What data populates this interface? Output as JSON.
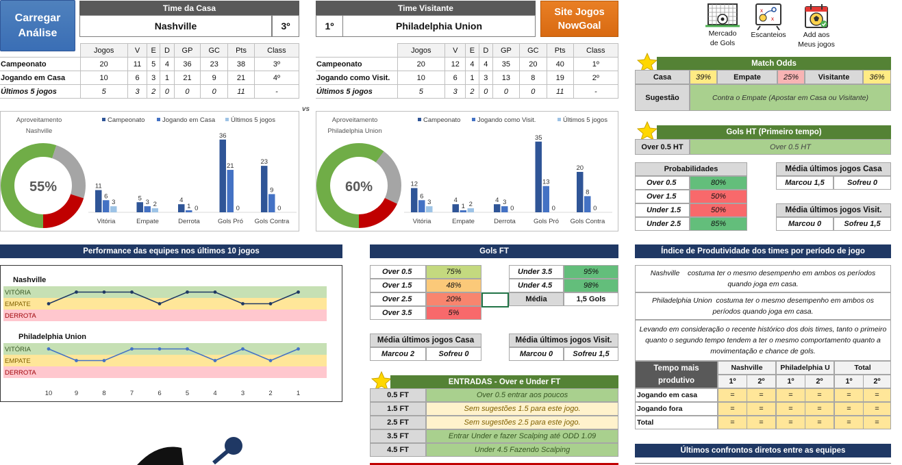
{
  "buttons": {
    "load": "Carregar\nAnálise",
    "site": "Site Jogos\nNowGoal"
  },
  "icons": [
    {
      "name": "goal-net-icon",
      "label": "Mercado\nde Gols"
    },
    {
      "name": "tactics-board-icon",
      "label": "Escanteios"
    },
    {
      "name": "calendar-ball-icon",
      "label": "Add aos\nMeus jogos"
    }
  ],
  "home": {
    "header": "Time da Casa",
    "name": "Nashville",
    "pos": "3º",
    "cols": [
      "Jogos",
      "V",
      "E",
      "D",
      "GP",
      "GC",
      "Pts",
      "Class"
    ],
    "rows": [
      {
        "label": "Campeonato",
        "vals": [
          "20",
          "11",
          "5",
          "4",
          "36",
          "23",
          "38",
          "3º"
        ],
        "italic": false
      },
      {
        "label": "Jogando em Casa",
        "vals": [
          "10",
          "6",
          "3",
          "1",
          "21",
          "9",
          "21",
          "4º"
        ],
        "italic": false
      },
      {
        "label": "Últimos 5 jogos",
        "vals": [
          "5",
          "3",
          "2",
          "0",
          "0",
          "0",
          "11",
          "-"
        ],
        "italic": true
      }
    ]
  },
  "away": {
    "header": "Time Visitante",
    "name": "Philadelphia Union",
    "pos": "1º",
    "cols": [
      "Jogos",
      "V",
      "E",
      "D",
      "GP",
      "GC",
      "Pts",
      "Class"
    ],
    "rows": [
      {
        "label": "Campeonato",
        "vals": [
          "20",
          "12",
          "4",
          "4",
          "35",
          "20",
          "40",
          "1º"
        ],
        "italic": false
      },
      {
        "label": "Jogando como Visit.",
        "vals": [
          "10",
          "6",
          "1",
          "3",
          "13",
          "8",
          "19",
          "2º"
        ],
        "italic": false
      },
      {
        "label": "Últimos 5 jogos",
        "vals": [
          "5",
          "3",
          "2",
          "0",
          "0",
          "0",
          "11",
          "-"
        ],
        "italic": true
      }
    ]
  },
  "vs": "vs",
  "chart_data": [
    {
      "type": "bar",
      "title": "Aproveitamento Nashville",
      "donut_value": "55%",
      "donut_fraction": 0.55,
      "categories": [
        "Vitória",
        "Empate",
        "Derrota",
        "Gols Pró",
        "Gols Contra"
      ],
      "series": [
        {
          "name": "Campeonato",
          "values": [
            11,
            5,
            4,
            36,
            23
          ],
          "color": "#2f5597"
        },
        {
          "name": "Jogando em Casa",
          "values": [
            6,
            3,
            1,
            21,
            9
          ],
          "color": "#4472c4"
        },
        {
          "name": "Últimos 5 jogos",
          "values": [
            3,
            2,
            0,
            0,
            0
          ],
          "color": "#9dc3e6"
        }
      ]
    },
    {
      "type": "bar",
      "title": "Aproveitamento Philadelphia Union",
      "donut_value": "60%",
      "donut_fraction": 0.6,
      "categories": [
        "Vitória",
        "Empate",
        "Derrota",
        "Gols Pró",
        "Gols Contra"
      ],
      "series": [
        {
          "name": "Campeonato",
          "values": [
            12,
            4,
            4,
            35,
            20
          ],
          "color": "#2f5597"
        },
        {
          "name": "Jogando como Visit.",
          "values": [
            6,
            1,
            3,
            13,
            8
          ],
          "color": "#4472c4"
        },
        {
          "name": "Últimos 5 jogos",
          "values": [
            3,
            2,
            0,
            0,
            0
          ],
          "color": "#9dc3e6"
        }
      ]
    },
    {
      "type": "line",
      "title": "Performance das equipes nos últimos 10 jogos",
      "x": [
        "10",
        "9",
        "8",
        "7",
        "6",
        "5",
        "4",
        "3",
        "2",
        "1"
      ],
      "bands": [
        "VITÓRIA",
        "EMPATE",
        "DERROTA"
      ],
      "series": [
        {
          "name": "Nashville",
          "values": [
            "E",
            "V",
            "V",
            "V",
            "E",
            "V",
            "V",
            "E",
            "E",
            "V"
          ]
        },
        {
          "name": "Philadelphia Union",
          "values": [
            "V",
            "E",
            "E",
            "V",
            "V",
            "V",
            "E",
            "V",
            "E",
            "V"
          ]
        }
      ]
    }
  ],
  "match_odds": {
    "title": "Match Odds",
    "casa_label": "Casa",
    "casa": "39%",
    "empate_label": "Empate",
    "empate": "25%",
    "visitante_label": "Visitante",
    "visitante": "36%",
    "sugestao_label": "Sugestão",
    "sugestao": "Contra o Empate (Apostar em Casa ou Visitante)"
  },
  "gols_ht": {
    "title": "Gols HT (Primeiro tempo)",
    "label": "Over 0.5 HT",
    "value": "Over 0.5 HT"
  },
  "probabilidades": {
    "title": "Probabilidades",
    "rows": [
      {
        "label": "Over 0.5",
        "value": "80%",
        "color": "#63be7b"
      },
      {
        "label": "Over 1.5",
        "value": "50%",
        "color": "#f8696b"
      },
      {
        "label": "Under 1.5",
        "value": "50%",
        "color": "#f8696b"
      },
      {
        "label": "Under 2.5",
        "value": "85%",
        "color": "#63be7b"
      }
    ]
  },
  "media_casa_r": {
    "title": "Média últimos jogos Casa",
    "marcou": "Marcou 1,5",
    "sofreu": "Sofreu 0"
  },
  "media_visit_r": {
    "title": "Média últimos jogos Visit.",
    "marcou": "Marcou 0",
    "sofreu": "Sofreu 1,5"
  },
  "gols_ft": {
    "title": "Gols FT",
    "left": [
      {
        "label": "Over 0.5",
        "value": "75%",
        "color": "#c4d97f"
      },
      {
        "label": "Over 1.5",
        "value": "48%",
        "color": "#fbc979"
      },
      {
        "label": "Over 2.5",
        "value": "20%",
        "color": "#f8856e"
      },
      {
        "label": "Over 3.5",
        "value": "5%",
        "color": "#f8696b"
      }
    ],
    "right": [
      {
        "label": "Under 3.5",
        "value": "95%",
        "color": "#63be7b"
      },
      {
        "label": "Under 4.5",
        "value": "98%",
        "color": "#63be7b"
      }
    ],
    "media_label": "Média",
    "media_value": "1,5 Gols"
  },
  "media_casa_m": {
    "title": "Média últimos jogos Casa",
    "marcou": "Marcou 2",
    "sofreu": "Sofreu 0"
  },
  "media_visit_m": {
    "title": "Média últimos jogos Visit.",
    "marcou": "Marcou 0",
    "sofreu": "Sofreu 1,5"
  },
  "entradas": {
    "title": "ENTRADAS - Over e Under FT",
    "rows": [
      {
        "label": "0.5 FT",
        "text": "Over 0.5 entrar aos poucos",
        "color": "#a9d08e"
      },
      {
        "label": "1.5 FT",
        "text": "Sem sugestões 1.5 para este jogo.",
        "color": "#fff2cc"
      },
      {
        "label": "2.5 FT",
        "text": "Sem sugestões 2.5 para este jogo.",
        "color": "#fff2cc"
      },
      {
        "label": "3.5 FT",
        "text": "Entrar Under e fazer Scalping até ODD 1.09",
        "color": "#a9d08e"
      },
      {
        "label": "4.5 FT",
        "text": "Under 4.5 Fazendo Scalping",
        "color": "#a9d08e"
      }
    ]
  },
  "indice": {
    "title": "Índice de Produtividade dos times por período de jogo",
    "p1": "Nashville    costuma ter o mesmo desempenho em ambos os períodos quando joga em casa.",
    "p2": "Philadelphia Union  costuma ter o mesmo desempenho em ambos os períodos quando joga em casa.",
    "p3": "Levando em consideração o recente histórico dos dois times, tanto o primeiro quanto o segundo tempo tendem a ter o mesmo comportamento quanto a movimentação e chance de gols.",
    "tempo_label": "Tempo mais produtivo",
    "teams": [
      "Nashville",
      "Philadelphia U",
      "Total"
    ],
    "halves": [
      "1º",
      "2º"
    ],
    "rows": [
      {
        "label": "Jogando em casa",
        "vals": [
          "=",
          "=",
          "=",
          "=",
          "=",
          "="
        ]
      },
      {
        "label": "Jogando fora",
        "vals": [
          "=",
          "=",
          "=",
          "=",
          "=",
          "="
        ]
      },
      {
        "label": "Total",
        "vals": [
          "=",
          "=",
          "=",
          "=",
          "=",
          "="
        ]
      }
    ]
  },
  "ultimos": {
    "title": "Últimos confrontos diretos entre as equipes"
  }
}
